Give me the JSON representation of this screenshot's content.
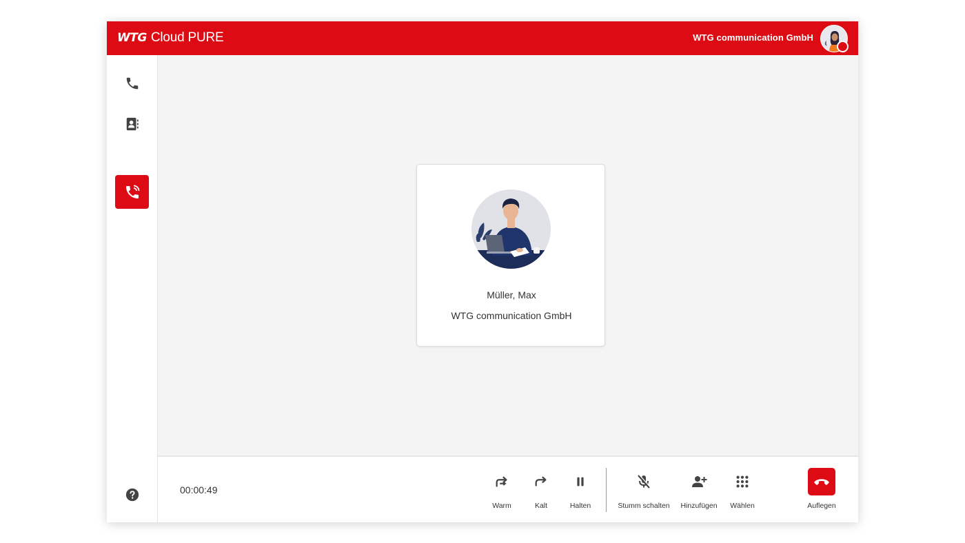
{
  "header": {
    "logo_brand": "WTG",
    "logo_product": "Cloud PURE",
    "company": "WTG communication GmbH",
    "brand_color": "#dd0b14"
  },
  "sidebar": {
    "items": [
      {
        "name": "phone",
        "icon": "phone-icon"
      },
      {
        "name": "contacts",
        "icon": "address-book-icon"
      },
      {
        "name": "active-call",
        "icon": "phone-ringing-icon"
      },
      {
        "name": "help",
        "icon": "help-icon"
      }
    ]
  },
  "contact": {
    "name": "Müller, Max",
    "company": "WTG communication GmbH"
  },
  "call": {
    "timer": "00:00:49",
    "controls": {
      "warm": "Warm",
      "cold": "Kalt",
      "hold": "Halten",
      "mute": "Stumm schalten",
      "add": "Hinzufügen",
      "dial": "Wählen",
      "hangup": "Auflegen"
    }
  }
}
